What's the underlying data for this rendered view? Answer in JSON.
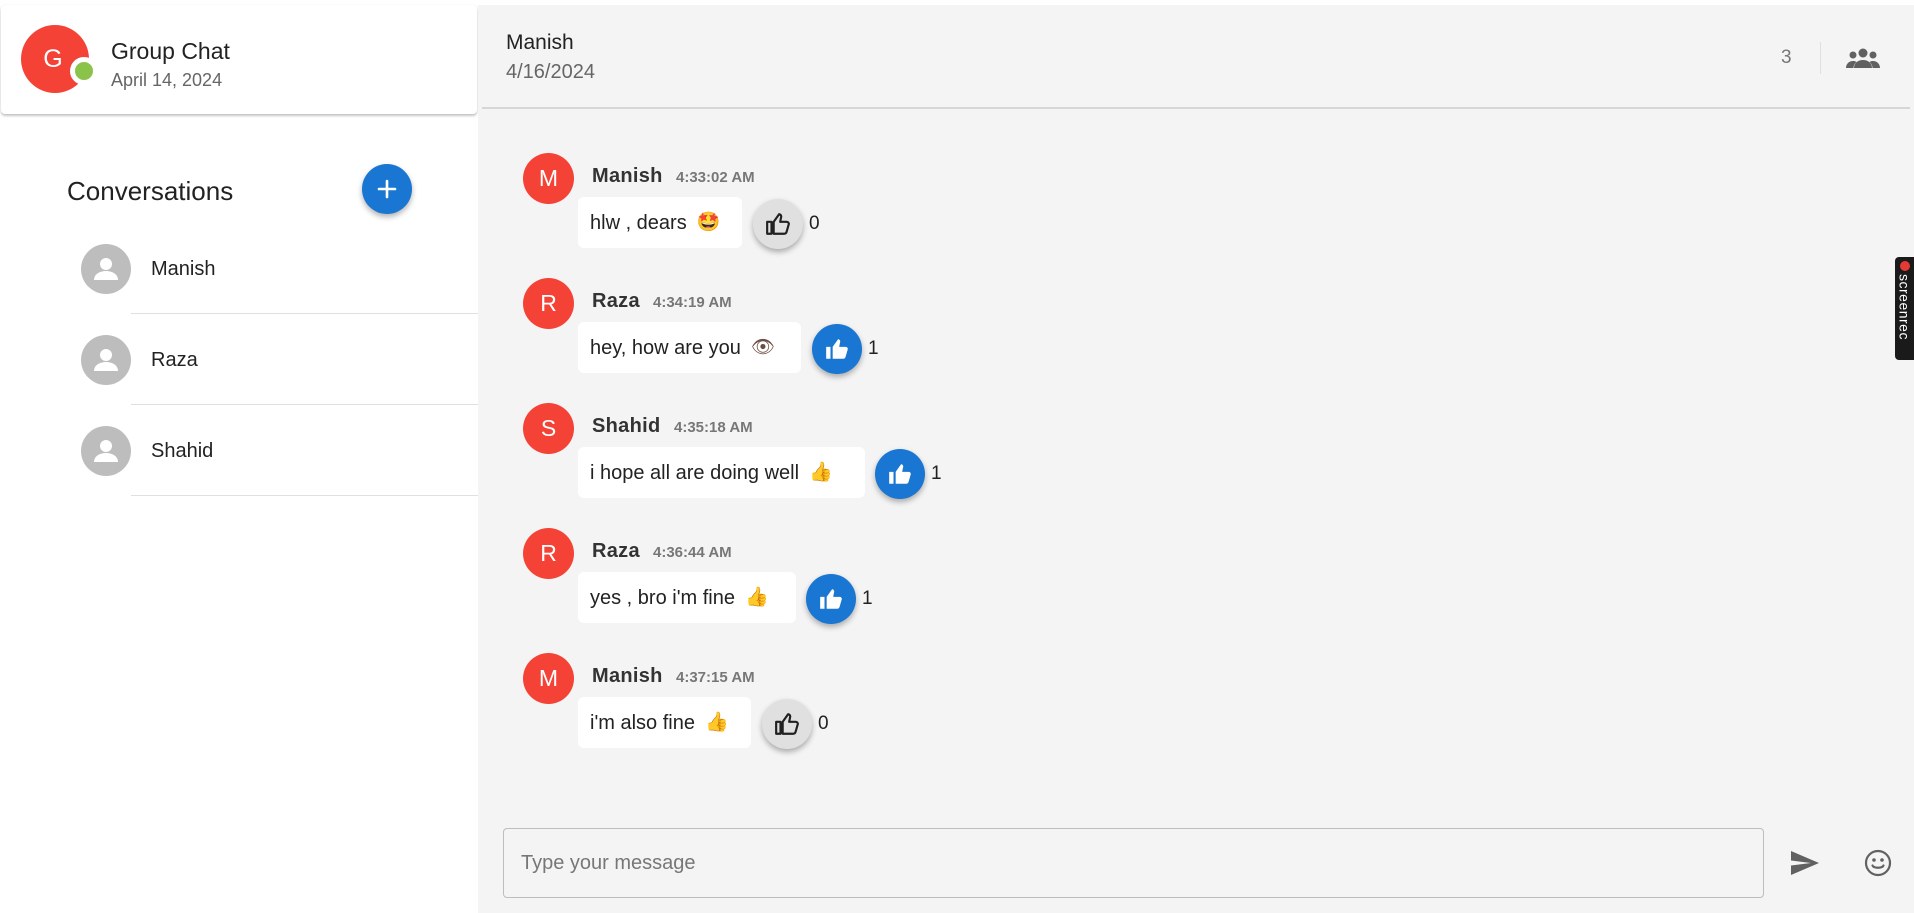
{
  "sidebar": {
    "group": {
      "avatar_letter": "G",
      "title": "Group Chat",
      "date": "April 14, 2024",
      "status_color": "#8bc34a"
    },
    "conversations_heading": "Conversations",
    "add_icon": "plus-icon",
    "conversations": [
      {
        "name": "Manish",
        "icon": "person-icon"
      },
      {
        "name": "Raza",
        "icon": "person-icon"
      },
      {
        "name": "Shahid",
        "icon": "person-icon"
      }
    ]
  },
  "chat": {
    "header": {
      "name": "Manish",
      "date": "4/16/2024",
      "member_count": "3",
      "people_icon": "group-icon"
    },
    "messages": [
      {
        "initial": "M",
        "sender": "Manish",
        "time": "4:33:02 AM",
        "text": "hlw , dears",
        "emoji": "🤩",
        "liked": false,
        "likes": "0"
      },
      {
        "initial": "R",
        "sender": "Raza",
        "time": "4:34:19 AM",
        "text": "hey, how are you",
        "emoji": "👁",
        "liked": true,
        "likes": "1"
      },
      {
        "initial": "S",
        "sender": "Shahid",
        "time": "4:35:18 AM",
        "text": "i hope all are doing well",
        "emoji": "👍",
        "liked": true,
        "likes": "1"
      },
      {
        "initial": "R",
        "sender": "Raza",
        "time": "4:36:44 AM",
        "text": "yes , bro i'm fine",
        "emoji": "👍",
        "liked": true,
        "likes": "1"
      },
      {
        "initial": "M",
        "sender": "Manish",
        "time": "4:37:15 AM",
        "text": "i'm also fine",
        "emoji": "👍",
        "liked": false,
        "likes": "0"
      }
    ],
    "composer": {
      "placeholder": "Type your message",
      "value": "",
      "send_icon": "send-icon",
      "emoji_icon": "emoji-icon"
    }
  },
  "overlay": {
    "screenrec_label": "screenrec"
  },
  "colors": {
    "primary": "#1976d2",
    "avatar_red": "#f44336",
    "chat_bg": "#f4f4f4"
  }
}
